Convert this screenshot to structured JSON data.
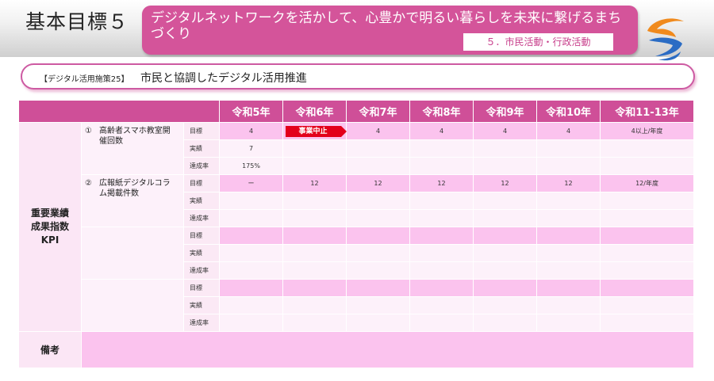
{
  "header": {
    "goal_label": "基本目標５",
    "goal_text": "デジタルネットワークを活かして、心豊かで明るい暮らしを未来に繋げるまちづくり",
    "goal_tag": "５．市民活動・行政活動"
  },
  "measure": {
    "tag": "【デジタル活用施策25】",
    "title": "市民と協調したデジタル活用推進"
  },
  "table": {
    "years": [
      "令和5年",
      "令和6年",
      "令和7年",
      "令和8年",
      "令和9年",
      "令和10年",
      "令和11-13年"
    ],
    "kpi_label": [
      "重要業績",
      "成果指数",
      "KPI"
    ],
    "row_labels": [
      "目標",
      "実績",
      "達成率"
    ],
    "items": [
      {
        "num": "①",
        "name": "高齢者スマホ教室開催回数",
        "target": [
          "4",
          "",
          "4",
          "4",
          "4",
          "4",
          "4以上/年度"
        ],
        "badge": "事業中止",
        "actual": [
          "7",
          "",
          "",
          "",
          "",
          "",
          ""
        ],
        "rate": [
          "175%",
          "",
          "",
          "",
          "",
          "",
          ""
        ]
      },
      {
        "num": "②",
        "name": "広報紙デジタルコラム掲載件数",
        "target": [
          "ー",
          "12",
          "12",
          "12",
          "12",
          "12",
          "12/年度"
        ],
        "actual": [
          "",
          "",
          "",
          "",
          "",
          "",
          ""
        ],
        "rate": [
          "",
          "",
          "",
          "",
          "",
          "",
          ""
        ]
      },
      {
        "num": "",
        "name": ""
      },
      {
        "num": "",
        "name": ""
      }
    ],
    "remarks_label": "備考"
  },
  "colors": {
    "accent": "#cf4f98",
    "pink_row": "#fbc3ee",
    "light_row": "#fdf1fa",
    "badge_red": "#e3001b"
  }
}
